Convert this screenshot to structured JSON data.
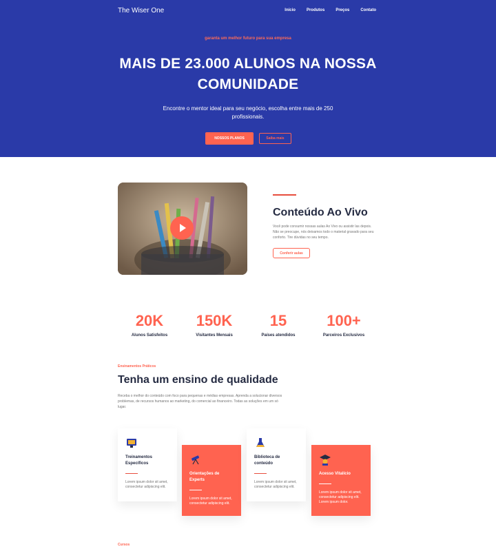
{
  "header": {
    "brand": "The Wiser One",
    "nav": [
      "Início",
      "Produtos",
      "Preços",
      "Contato"
    ]
  },
  "hero": {
    "tagline": "garanta um melhor futuro para sua empresa",
    "headline": "MAIS DE 23.000 ALUNOS NA NOSSA COMUNIDADE",
    "subtitle": "Encontre o mentor ideal para seu negócio, escolha entre mais de 250 profissionais.",
    "primary_button": "NOSSOS PLANOS",
    "secondary_button": "Saiba mais"
  },
  "live": {
    "title": "Conteúdo Ao Vivo",
    "text": "Você pode consumir nossas aulas Ao Vivo ou assistir las depois. Não se preocupe, nós deixamos todo o material gravado para seu conforto. Tire dúvidas no seu tempo.",
    "button": "Conferir aulas"
  },
  "stats": [
    {
      "value": "20K",
      "label": "Alunos Satisfeitos"
    },
    {
      "value": "150K",
      "label": "Visitantes Mensais"
    },
    {
      "value": "15",
      "label": "Países atendidos"
    },
    {
      "value": "100+",
      "label": "Parceiros Exclusivos"
    }
  ],
  "quality": {
    "eyebrow": "Ensinamentos Práticos",
    "title": "Tenha um ensino de qualidade",
    "text": "Receba o melhor do conteúdo com foco para pequenas e médias empresas. Aprenda a solucionar diversos problemas, de recursos humanos ao marketing, do comercial ao financeiro. Todas as soluções em um só lugar."
  },
  "cards": [
    {
      "title": "Treinamentos Específicos",
      "text": "Lorem ipsum dolor sit amet, consectetur adipiscing elit.",
      "icon": "screen-icon"
    },
    {
      "title": "Orientações de Experts",
      "text": "Lorem ipsum dolor sit amet, consectetur adipiscing elit.",
      "icon": "telescope-icon"
    },
    {
      "title": "Biblioteca de conteúdo",
      "text": "Lorem ipsum dolor sit amet, consectetur adipiscing elit.",
      "icon": "flask-icon"
    },
    {
      "title": "Acesso Vitalício",
      "text": "Lorem ipsum dolor sit amet, consectetur adipiscing elit. Lorem ipsum dolor.",
      "icon": "graduate-icon"
    }
  ],
  "courses": {
    "eyebrow": "Cursos"
  },
  "colors": {
    "hero_bg": "#2a3aa8",
    "accent": "#ff6350",
    "dark_text": "#252b42",
    "muted_text": "#737373"
  }
}
